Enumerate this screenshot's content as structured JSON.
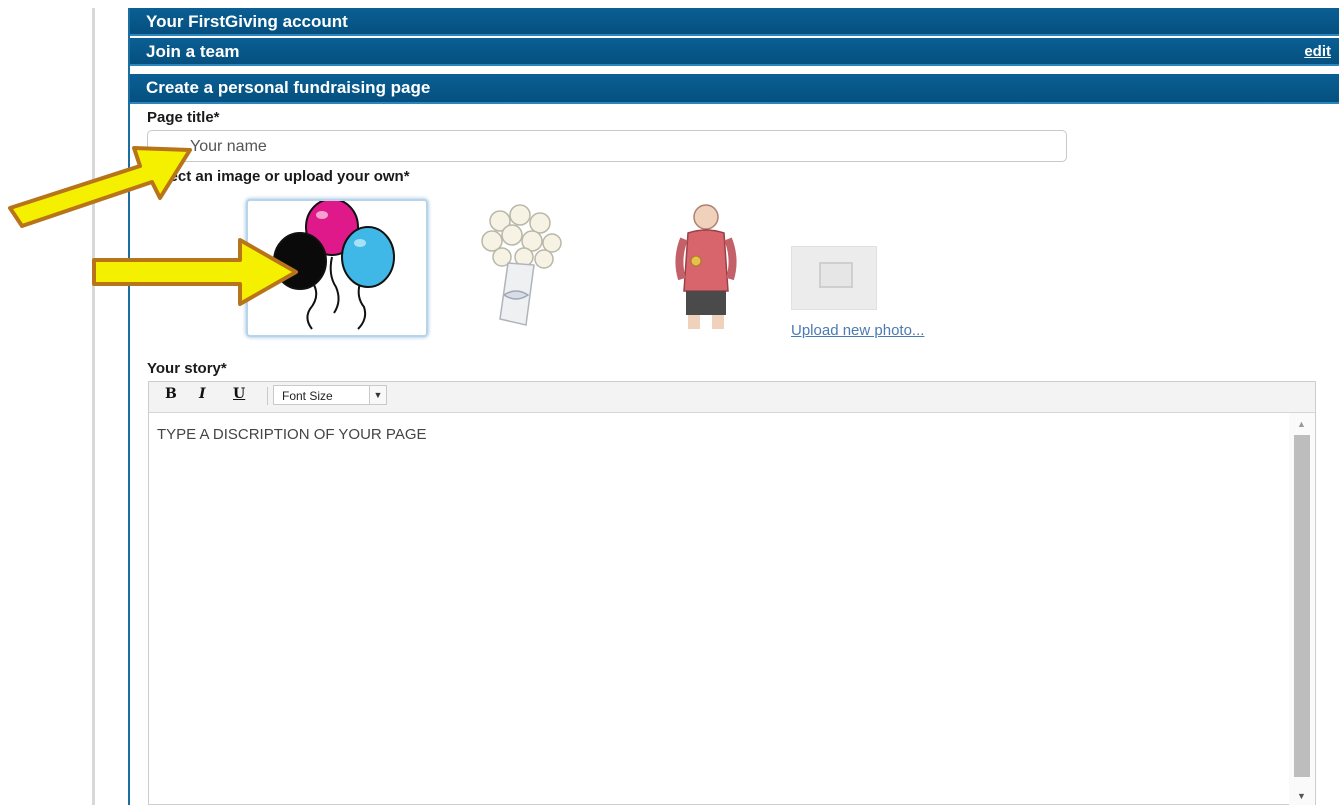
{
  "sections": {
    "account_title": "Your FirstGiving account",
    "join_team_title": "Join a team",
    "join_team_edit": "edit",
    "create_page_title": "Create a personal fundraising page"
  },
  "page_title": {
    "label": "Page title*",
    "value": "Your name"
  },
  "image_select": {
    "label": "Select an image or upload your own*",
    "options": [
      "balloons",
      "flower-bouquet",
      "athlete-with-medal"
    ],
    "selected": "balloons",
    "upload_link": "Upload new photo..."
  },
  "story": {
    "label": "Your story*",
    "toolbar": {
      "bold": "B",
      "italic": "I",
      "underline": "U",
      "font_size": "Font Size"
    },
    "content": "TYPE A DISCRIPTION OF YOUR PAGE"
  },
  "colors": {
    "header_bar": "#05507f",
    "annotation_arrow_fill": "#f5f000",
    "annotation_arrow_outline": "#b8741a",
    "link": "#4a7bb0"
  }
}
